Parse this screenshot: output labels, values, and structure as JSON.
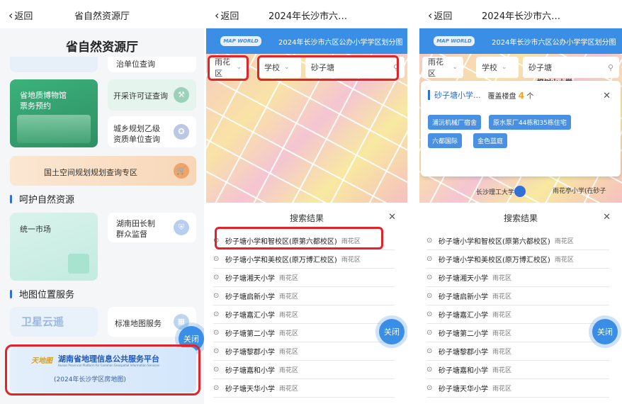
{
  "common": {
    "back_label": "返回",
    "close_button": "关闭"
  },
  "panel1": {
    "title": "省自然资源厅",
    "heading": "省自然资源厅",
    "cards": {
      "units_query": "治单位查询",
      "museum_line1": "省地质博物馆",
      "museum_line2": "票务预约",
      "mining_permit": "开采许可证查询",
      "urban_plan_line1": "城乡规划乙级",
      "urban_plan_line2": "资质单位查询",
      "land_plan": "国土空间规划规划查询专区",
      "market": "统一市场",
      "field_chief_line1": "湖南田长制",
      "field_chief_line2": "群众监督",
      "satellite": "卫星云遥",
      "standard_map": "标准地图服务"
    },
    "sections": {
      "nature": "呵护自然资源",
      "map_service": "地图位置服务"
    },
    "platform": {
      "logo_text": "天地图",
      "name": "湖南省地理信息公共服务平台",
      "subtitle_en": "Hunan Provincial Platform for Common Geospatial Information Services",
      "note": "(2024年长沙学区房地图)"
    }
  },
  "panel2": {
    "title": "2024年长沙市六…",
    "logo": "MAP WORLD",
    "banner_text": "2024年长沙市六区公办小学学区划分图",
    "district_select": "雨花区",
    "type_select": "学校",
    "search_value": "砂子塘",
    "results_title": "搜索结果",
    "results": [
      {
        "name": "砂子塘小学和智校区(原第六都校区)",
        "district": "雨花区"
      },
      {
        "name": "砂子塘小学和美校区(原万博汇校区)",
        "district": "雨花区"
      },
      {
        "name": "砂子塘湘天小学",
        "district": "雨花区"
      },
      {
        "name": "砂子塘启新小学",
        "district": "雨花区"
      },
      {
        "name": "砂子塘嘉汇小学",
        "district": "雨花区"
      },
      {
        "name": "砂子塘第二小学",
        "district": "雨花区"
      },
      {
        "name": "砂子塘黎郡小学",
        "district": "雨花区"
      },
      {
        "name": "砂子塘嘉和小学",
        "district": "雨花区"
      },
      {
        "name": "砂子塘天华小学",
        "district": "雨花区"
      }
    ]
  },
  "panel3": {
    "title": "2024年长沙市六…",
    "popup_title": "砂子塘小学...",
    "popup_cover_label": "覆盖楼盘",
    "popup_count": "4",
    "popup_unit": "个",
    "tags": [
      "浦沅机械厂宿舍",
      "原水泵厂44栋和35栋住宅",
      "六都国际",
      "金色蓝庭"
    ],
    "map_label_top": "枫树山小学",
    "map_label_bottom_left": "长沙理工大学",
    "map_label_bottom_right": "雨花亭小学(在砂子"
  },
  "colors": {
    "accent": "#3a8ee6",
    "highlight_red": "#e0242a"
  }
}
